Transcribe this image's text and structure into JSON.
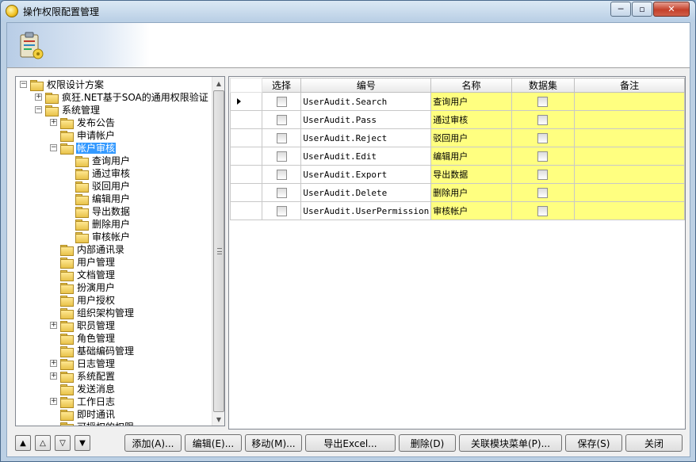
{
  "window": {
    "title": "操作权限配置管理",
    "minimize_glyph": "─",
    "maximize_glyph": "▫",
    "close_glyph": "✕"
  },
  "tree": {
    "nodes": [
      {
        "label": "权限设计方案",
        "level": 0,
        "expander": "−"
      },
      {
        "label": "疯狂.NET基于SOA的通用权限验证",
        "level": 1,
        "expander": "+"
      },
      {
        "label": "系统管理",
        "level": 1,
        "expander": "−"
      },
      {
        "label": "发布公告",
        "level": 2,
        "expander": "+"
      },
      {
        "label": "申请帐户",
        "level": 2,
        "expander": ""
      },
      {
        "label": "帐户审核",
        "level": 2,
        "expander": "−",
        "selected": true
      },
      {
        "label": "查询用户",
        "level": 3,
        "expander": ""
      },
      {
        "label": "通过审核",
        "level": 3,
        "expander": ""
      },
      {
        "label": "驳回用户",
        "level": 3,
        "expander": ""
      },
      {
        "label": "编辑用户",
        "level": 3,
        "expander": ""
      },
      {
        "label": "导出数据",
        "level": 3,
        "expander": ""
      },
      {
        "label": "删除用户",
        "level": 3,
        "expander": ""
      },
      {
        "label": "审核帐户",
        "level": 3,
        "expander": ""
      },
      {
        "label": "内部通讯录",
        "level": 2,
        "expander": ""
      },
      {
        "label": "用户管理",
        "level": 2,
        "expander": ""
      },
      {
        "label": "文档管理",
        "level": 2,
        "expander": ""
      },
      {
        "label": "扮演用户",
        "level": 2,
        "expander": ""
      },
      {
        "label": "用户授权",
        "level": 2,
        "expander": ""
      },
      {
        "label": "组织架构管理",
        "level": 2,
        "expander": ""
      },
      {
        "label": "职员管理",
        "level": 2,
        "expander": "+"
      },
      {
        "label": "角色管理",
        "level": 2,
        "expander": ""
      },
      {
        "label": "基础编码管理",
        "level": 2,
        "expander": ""
      },
      {
        "label": "日志管理",
        "level": 2,
        "expander": "+"
      },
      {
        "label": "系统配置",
        "level": 2,
        "expander": "+"
      },
      {
        "label": "发送消息",
        "level": 2,
        "expander": ""
      },
      {
        "label": "工作日志",
        "level": 2,
        "expander": "+"
      },
      {
        "label": "即时通讯",
        "level": 2,
        "expander": ""
      },
      {
        "label": "可授权的权限",
        "level": 2,
        "expander": ""
      }
    ]
  },
  "grid": {
    "columns": [
      "选择",
      "编号",
      "名称",
      "数据集",
      "备注"
    ],
    "rows": [
      {
        "code": "UserAudit.Search",
        "name": "查询用户",
        "remark": ""
      },
      {
        "code": "UserAudit.Pass",
        "name": "通过审核",
        "remark": ""
      },
      {
        "code": "UserAudit.Reject",
        "name": "驳回用户",
        "remark": ""
      },
      {
        "code": "UserAudit.Edit",
        "name": "编辑用户",
        "remark": ""
      },
      {
        "code": "UserAudit.Export",
        "name": "导出数据",
        "remark": ""
      },
      {
        "code": "UserAudit.Delete",
        "name": "删除用户",
        "remark": ""
      },
      {
        "code": "UserAudit.UserPermission",
        "name": "审核帐户",
        "remark": ""
      }
    ]
  },
  "nav_buttons": [
    "▲",
    "△",
    "▽",
    "▼"
  ],
  "actions": {
    "add": "添加(A)...",
    "edit": "编辑(E)...",
    "move": "移动(M)...",
    "export": "导出Excel...",
    "delete": "删除(D)",
    "link_menu": "关联模块菜单(P)...",
    "save": "保存(S)",
    "close": "关闭"
  }
}
